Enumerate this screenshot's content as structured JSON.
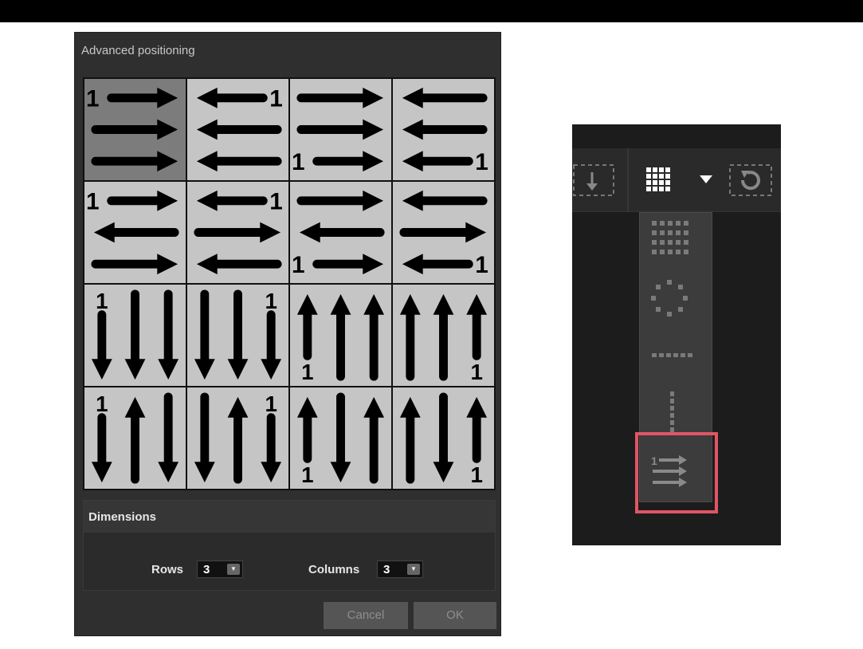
{
  "dialog": {
    "title": "Advanced positioning",
    "selected_cell": 0,
    "dimensions": {
      "header": "Dimensions",
      "rows_label": "Rows",
      "rows_value": "3",
      "columns_label": "Columns",
      "columns_value": "3"
    },
    "buttons": {
      "cancel": "Cancel",
      "ok": "OK"
    }
  },
  "order_marker": "1",
  "panel": {
    "toolbar_icons": [
      "download-icon",
      "grid-layout-icon",
      "dropdown-arrow-icon",
      "reset-icon"
    ],
    "dropdown_items": [
      "grid-layout-icon",
      "circle-layout-icon",
      "line-horizontal-icon",
      "line-vertical-icon",
      "ordering-icon"
    ],
    "highlight_color": "#e05565"
  }
}
